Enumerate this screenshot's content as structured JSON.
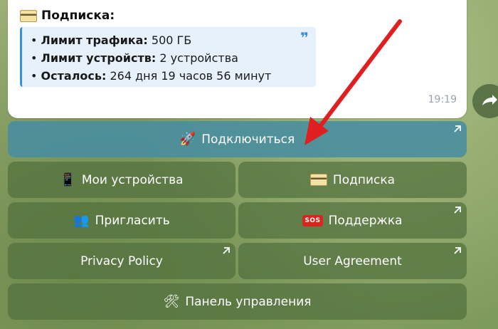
{
  "message": {
    "title": "Подписка:",
    "rows": [
      {
        "label": "Лимит трафика:",
        "value": " 500 ГБ"
      },
      {
        "label": "Лимит устройств:",
        "value": " 2 устройства"
      },
      {
        "label": "Осталось:",
        "value": " 264 дня 19 часов 56 минут"
      }
    ],
    "time": "19:19"
  },
  "buttons": {
    "connect": "Подключиться",
    "devices": "Мои устройства",
    "subscription": "Подписка",
    "invite": "Пригласить",
    "support": "Поддержка",
    "privacy": "Privacy Policy",
    "agreement": "User Agreement",
    "admin": "Панель управления"
  },
  "icons": {
    "connect": "rocket-icon",
    "devices": "phone-icon",
    "subscription": "credit-card-icon",
    "invite": "people-icon",
    "support": "sos-icon",
    "admin": "tools-icon"
  },
  "sos_text": "SOS",
  "colors": {
    "accent": "#3a8fd9",
    "primary_button": "#478da0",
    "button": "#52703e",
    "arrow": "#e02020"
  }
}
